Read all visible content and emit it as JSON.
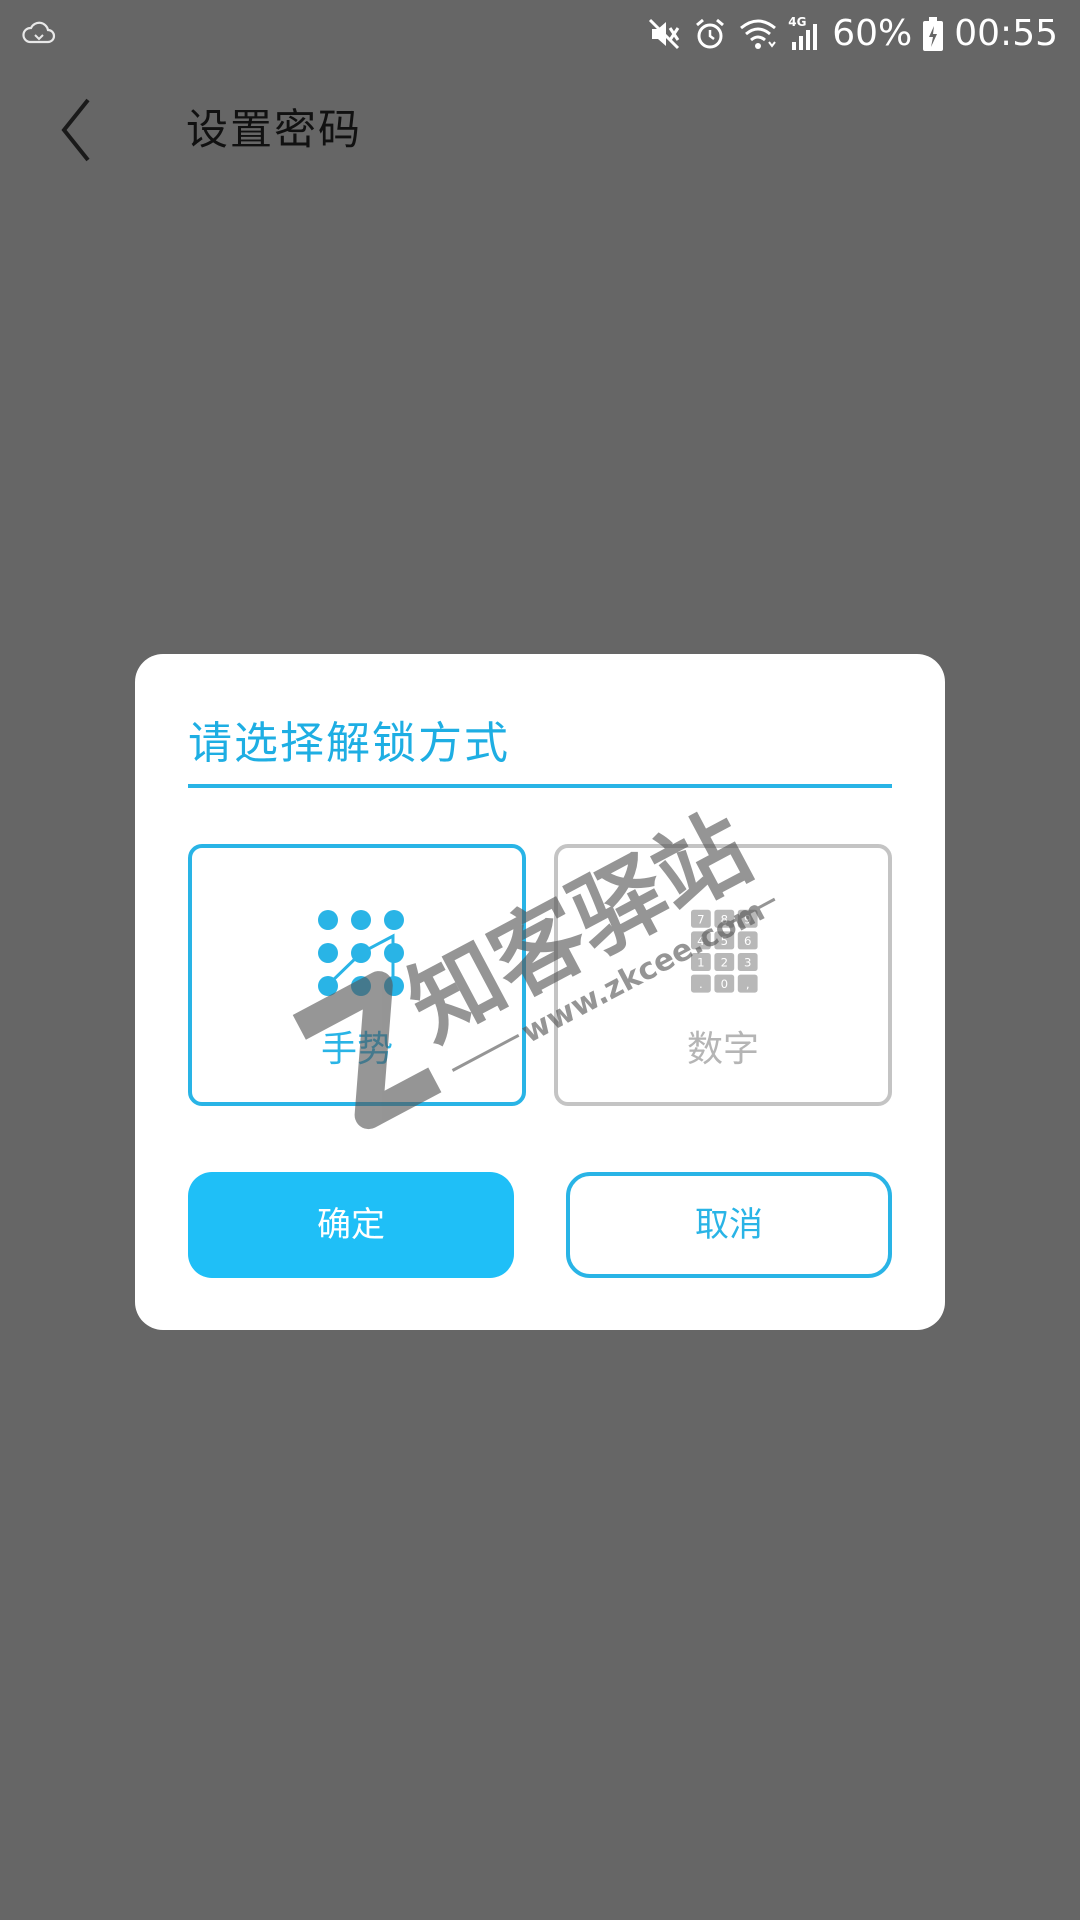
{
  "status_bar": {
    "battery": "60%",
    "time": "00:55",
    "network_label": "4G",
    "icons": [
      "cloud-sync-icon",
      "mute-icon",
      "alarm-icon",
      "wifi-icon",
      "signal-icon",
      "battery-icon"
    ]
  },
  "header": {
    "back_icon": "chevron-left-icon",
    "title": "设置密码"
  },
  "dialog": {
    "title": "请选择解锁方式",
    "options": [
      {
        "label": "手势",
        "icon": "pattern-grid-icon",
        "selected": true
      },
      {
        "label": "数字",
        "icon": "numeric-keypad-icon",
        "selected": false
      }
    ],
    "keypad_keys": [
      "7",
      "8",
      "9",
      "4",
      "5",
      "6",
      "1",
      "2",
      "3",
      ".",
      "0",
      ","
    ],
    "confirm_label": "确定",
    "cancel_label": "取消"
  },
  "watermark": {
    "text": "知客驿站",
    "url": "www.zkcee.com"
  },
  "colors": {
    "background": "#666666",
    "accent": "#29b4e6",
    "confirm_button": "#1fbff7",
    "inactive_border": "#c4c4c4",
    "inactive_text": "#b5b5b5"
  }
}
